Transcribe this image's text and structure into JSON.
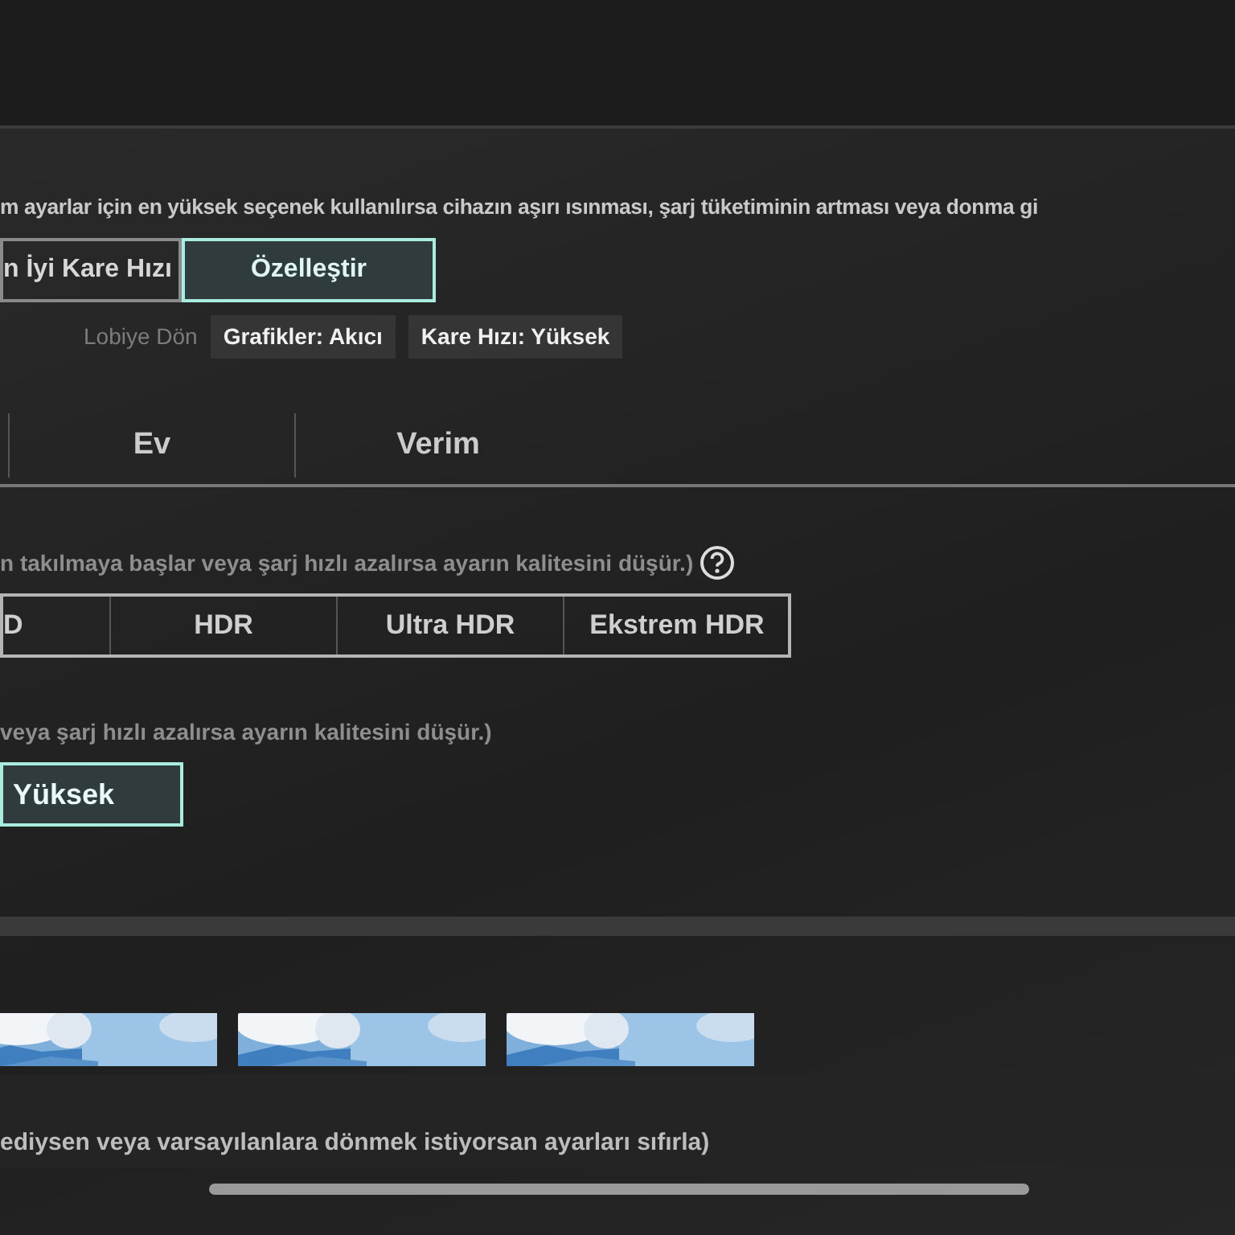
{
  "warning": "m ayarlar için en yüksek seçenek kullanılırsa cihazın aşırı ısınması, şarj tüketiminin artması veya donma gi",
  "mode_buttons": [
    {
      "label": "n İyi Kare Hızı",
      "selected": false
    },
    {
      "label": "Özelleştir",
      "selected": true
    }
  ],
  "lobby_label": "Lobiye Dön",
  "status_chips": [
    "Grafikler: Akıcı",
    "Kare Hızı: Yüksek"
  ],
  "tabs": [
    {
      "label": "Ev",
      "selected": false
    },
    {
      "label": "Verim",
      "selected": false
    }
  ],
  "style_hint": "n takılmaya başlar veya şarj hızlı azalırsa ayarın kalitesini düşür.)",
  "style_options": [
    {
      "label": "D",
      "selected": false
    },
    {
      "label": "HDR",
      "selected": false
    },
    {
      "label": "Ultra HDR",
      "selected": false
    },
    {
      "label": "Ekstrem HDR",
      "selected": false
    }
  ],
  "frame_hint": "veya şarj hızlı azalırsa ayarın kalitesini düşür.)",
  "frame_options": [
    {
      "label": "Yüksek",
      "selected": true
    }
  ],
  "previews": [
    {
      "kind": "picture"
    },
    {
      "kind": "picture"
    },
    {
      "kind": "picture"
    }
  ],
  "reset_hint": "ediysen veya varsayılanlara dönmek istiyorsan ayarları sıfırla)"
}
